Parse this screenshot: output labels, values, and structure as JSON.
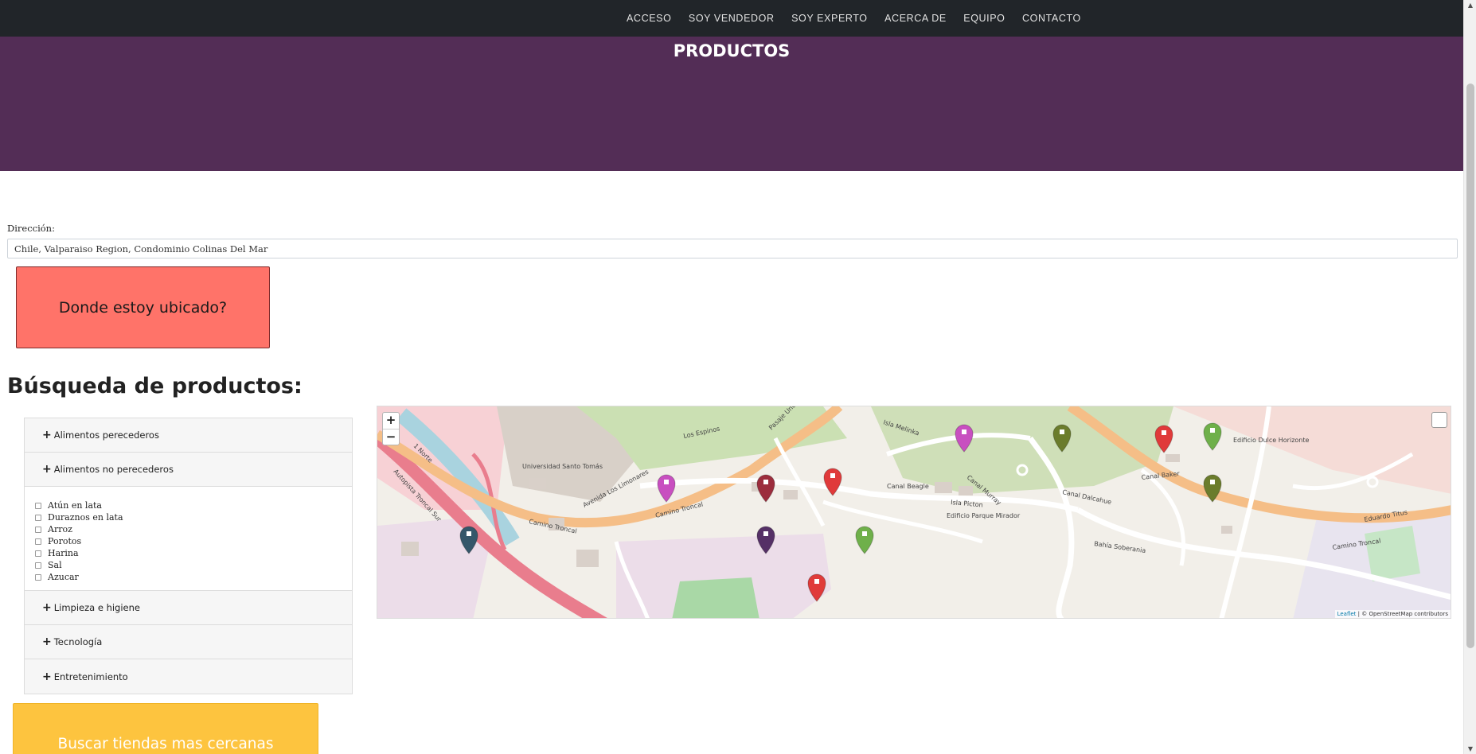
{
  "nav": {
    "items": [
      "ACCESO",
      "SOY VENDEDOR",
      "SOY EXPERTO",
      "ACERCA DE",
      "EQUIPO",
      "CONTACTO"
    ]
  },
  "header": {
    "title": "PRODUCTOS"
  },
  "address": {
    "label": "Dirección:",
    "value": "Chile, Valparaiso Region, Condominio Colinas Del Mar"
  },
  "locate_button": "Donde estoy ubicado?",
  "search": {
    "title": "Búsqueda de productos:",
    "categories": [
      {
        "label": "Alimentos perecederos"
      },
      {
        "label": "Alimentos no perecederos",
        "expanded": true,
        "options": [
          "Atún en lata",
          "Duraznos en lata",
          "Arroz",
          "Porotos",
          "Harina",
          "Sal",
          "Azucar"
        ]
      },
      {
        "label": "Limpieza e higiene"
      },
      {
        "label": "Tecnología"
      },
      {
        "label": "Entretenimiento"
      }
    ]
  },
  "find_button": "Buscar tiendas mas cercanas",
  "map": {
    "zoom_in": "+",
    "zoom_out": "−",
    "attribution_link": "Leaflet",
    "attribution_text": " | © OpenStreetMap contributors",
    "labels": [
      "Camino Troncal",
      "Autopista Troncal Sur",
      "Isla Picton",
      "Canal Beagle",
      "Eduardo Titus",
      "Bahía Soberania",
      "Canal Murray",
      "Canal Dalcahue",
      "Avenida Los Limonares",
      "1 Norte",
      "Los Espinos",
      "Pasaje Uno",
      "Isla Melinka",
      "Canal Baker",
      "Edificio Dulce Horizonte",
      "Edificio Parque Mirador",
      "Universidad Santo Tomás"
    ],
    "marker_colors": [
      "#c84fc0",
      "#9c2d3d",
      "#e03a3a",
      "#c84fc0",
      "#6b7c2c",
      "#e03a3a",
      "#6fb04a",
      "#6b7c2c",
      "#35576a",
      "#553066",
      "#6fb04a",
      "#e03a3a"
    ]
  },
  "scrollbar": {
    "up": "▲",
    "down": "▼"
  }
}
